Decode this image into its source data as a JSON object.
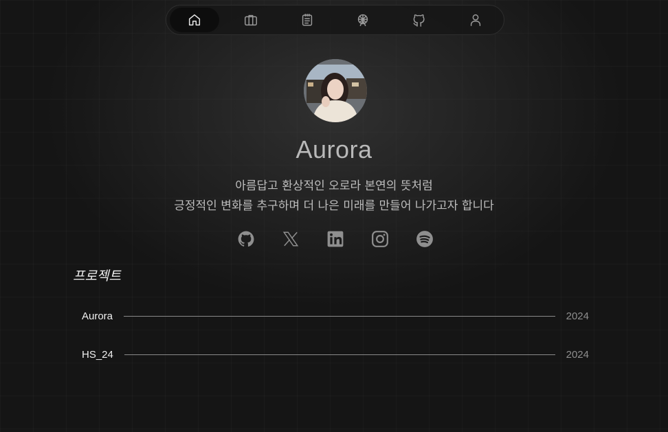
{
  "nav": {
    "items": [
      {
        "icon": "home-icon",
        "active": true
      },
      {
        "icon": "briefcase-icon",
        "active": false
      },
      {
        "icon": "notepad-icon",
        "active": false
      },
      {
        "icon": "ferris-wheel-icon",
        "active": false
      },
      {
        "icon": "github-icon",
        "active": false
      },
      {
        "icon": "user-icon",
        "active": false
      }
    ]
  },
  "profile": {
    "name": "Aurora",
    "bio_line1": "아름답고 환상적인 오로라 본연의 뜻처럼",
    "bio_line2": "긍정적인 변화를 추구하며 더 나은 미래를 만들어 나가고자 합니다"
  },
  "social": [
    "github-icon",
    "x-icon",
    "linkedin-icon",
    "instagram-icon",
    "spotify-icon"
  ],
  "projects": {
    "title": "프로젝트",
    "items": [
      {
        "name": "Aurora",
        "year": "2024"
      },
      {
        "name": "HS_24",
        "year": "2024"
      }
    ]
  },
  "colors": {
    "background": "#151515",
    "text": "#d8d8d8",
    "icon": "#9a9a9a",
    "active_icon": "#e8e8e8"
  }
}
